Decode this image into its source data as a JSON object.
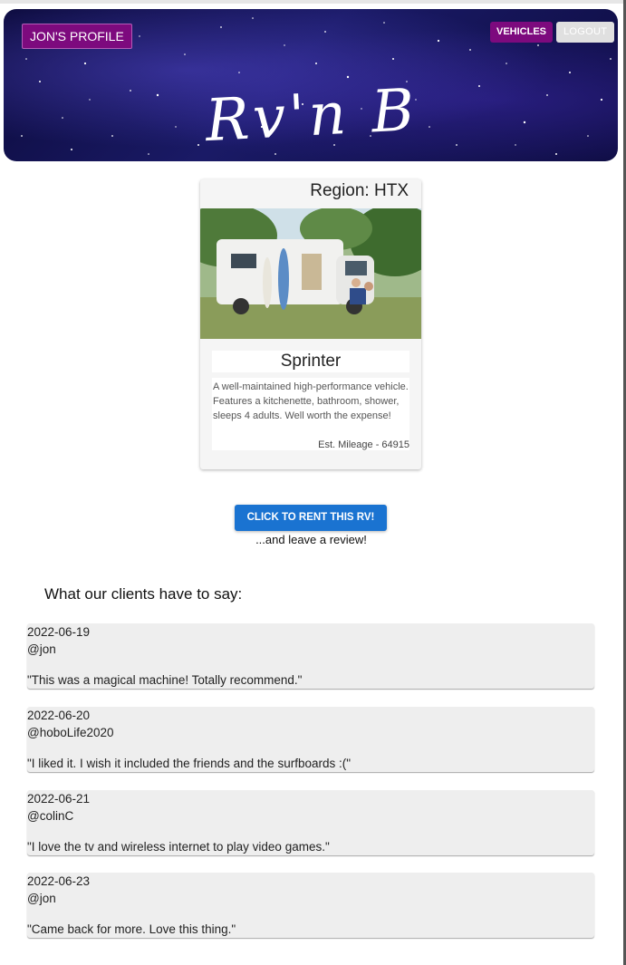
{
  "header": {
    "profile_label": "JON'S PROFILE",
    "vehicles_label": "VEHICLES",
    "logout_label": "LOGOUT",
    "logo_text": "Rv'n B"
  },
  "listing": {
    "region": "Region: HTX",
    "title": "Sprinter",
    "description": "A well-maintained high-performance vehicle. Features a kitchenette, bathroom, shower, sleeps 4 adults. Well worth the expense!",
    "mileage": "Est. Mileage - 64915"
  },
  "cta": {
    "rent_label": "CLICK TO RENT THIS RV!",
    "subtext": "...and leave a review!"
  },
  "reviews": {
    "heading": "What our clients have to say:",
    "items": [
      {
        "date": "2022-06-19",
        "user": "@jon",
        "text": "\"This was a magical machine! Totally recommend.\""
      },
      {
        "date": "2022-06-20",
        "user": "@hoboLife2020",
        "text": "\"I liked it. I wish it included the friends and the surfboards :(\""
      },
      {
        "date": "2022-06-21",
        "user": "@colinC",
        "text": "\"I love the tv and wireless internet to play video games.\""
      },
      {
        "date": "2022-06-23",
        "user": "@jon",
        "text": "\"Came back for more. Love this thing.\""
      }
    ]
  },
  "colors": {
    "brand_purple": "#7d0a7e",
    "primary_blue": "#1a73d1",
    "review_bg": "#eeeeee"
  }
}
